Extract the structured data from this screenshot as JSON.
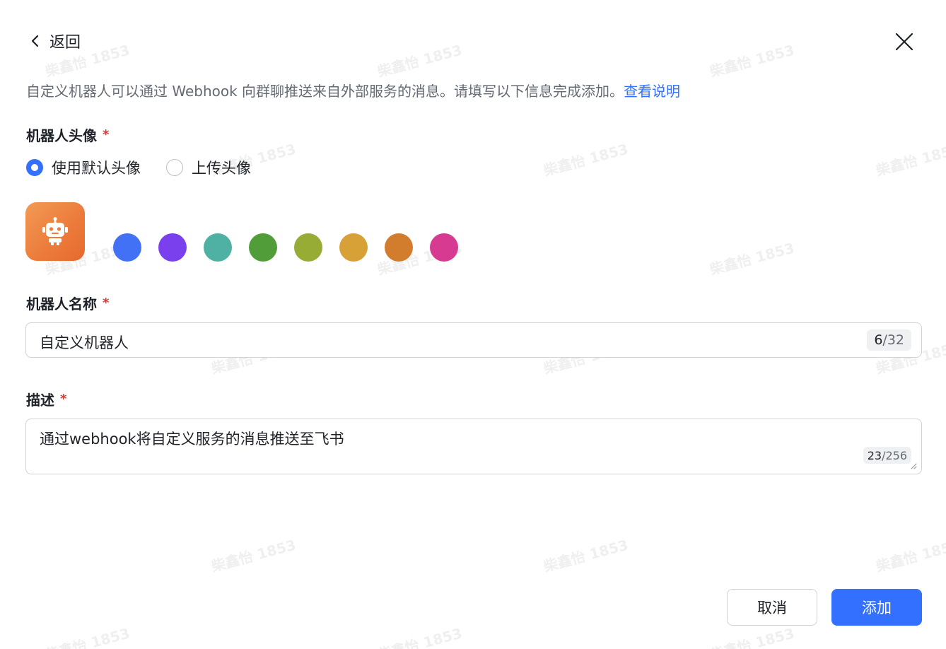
{
  "header": {
    "back_label": "返回"
  },
  "intro": {
    "text": "自定义机器人可以通过 Webhook 向群聊推送来自外部服务的消息。请填写以下信息完成添加。",
    "link_text": "查看说明"
  },
  "avatar_section": {
    "label": "机器人头像",
    "required_mark": "*",
    "options": [
      {
        "label": "使用默认头像",
        "checked": true
      },
      {
        "label": "上传头像",
        "checked": false
      }
    ],
    "avatar_icon": "robot-icon",
    "avatar_color": "#ec7a3a",
    "swatch_colors": [
      "#4371f6",
      "#7b40ee",
      "#4eb1a3",
      "#519d39",
      "#97ac34",
      "#d7a138",
      "#d27c2e",
      "#d63a91"
    ]
  },
  "name_section": {
    "label": "机器人名称",
    "required_mark": "*",
    "value": "自定义机器人",
    "count_current": "6",
    "count_sep_max": "/32"
  },
  "desc_section": {
    "label": "描述",
    "required_mark": "*",
    "value": "通过webhook将自定义服务的消息推送至飞书",
    "count_current": "23",
    "count_sep_max": "/256"
  },
  "footer": {
    "cancel_label": "取消",
    "add_label": "添加"
  },
  "colors": {
    "accent": "#3370ff",
    "required": "#d83931"
  },
  "watermark": "柴鑫怡 1853"
}
